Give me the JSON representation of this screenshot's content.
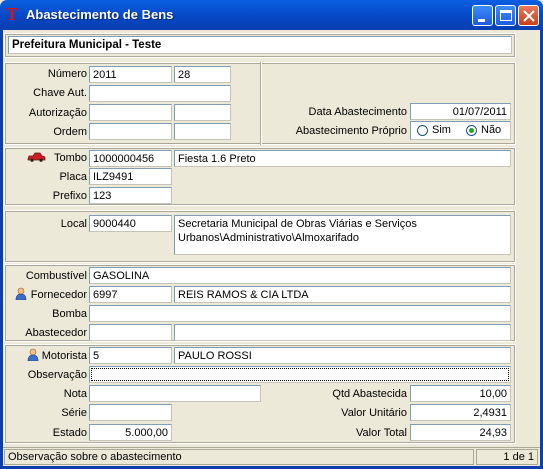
{
  "window": {
    "title": "Abastecimento de Bens"
  },
  "header": {
    "org": "Prefeitura Municipal - Teste"
  },
  "doc": {
    "numero_label": "Número",
    "numero": "2011",
    "numero2": "28",
    "chave_label": "Chave Aut.",
    "chave": "",
    "autorizacao_label": "Autorização",
    "autorizacao": "",
    "autorizacao2": "",
    "ordem_label": "Ordem",
    "ordem": "",
    "ordem2": "",
    "data_label": "Data Abastecimento",
    "data": "01/07/2011",
    "proprio_label": "Abastecimento Próprio",
    "sim": "Sim",
    "nao": "Não",
    "proprio_selected": "Não"
  },
  "vehicle": {
    "tombo_label": "Tombo",
    "tombo": "1000000456",
    "descricao": "Fiesta 1.6 Preto",
    "placa_label": "Placa",
    "placa": "ILZ9491",
    "prefixo_label": "Prefixo",
    "prefixo": "123"
  },
  "location": {
    "local_label": "Local",
    "local_code": "9000440",
    "local_desc": "Secretaria Municipal de Obras Viárias e Serviços Urbanos\\Administrativo\\Almoxarifado"
  },
  "supply": {
    "combustivel_label": "Combustível",
    "combustivel": "GASOLINA",
    "fornecedor_label": "Fornecedor",
    "fornecedor_code": "6997",
    "fornecedor_name": "REIS RAMOS & CIA LTDA",
    "bomba_label": "Bomba",
    "bomba": "",
    "abastecedor_label": "Abastecedor",
    "abastecedor_code": "",
    "abastecedor_name": ""
  },
  "driver": {
    "motorista_label": "Motorista",
    "motorista_code": "5",
    "motorista_name": "PAULO ROSSI",
    "observacao_label": "Observação",
    "observacao": "",
    "nota_label": "Nota",
    "nota": "",
    "serie_label": "Série",
    "serie": "",
    "estado_label": "Estado",
    "estado": "5.000,00",
    "qtd_label": "Qtd Abastecida",
    "qtd": "10,00",
    "valor_unit_label": "Valor Unitário",
    "valor_unit": "2,4931",
    "valor_total_label": "Valor Total",
    "valor_total": "24,93"
  },
  "status": {
    "hint": "Observação sobre o abastecimento",
    "page": "1 de 1"
  }
}
